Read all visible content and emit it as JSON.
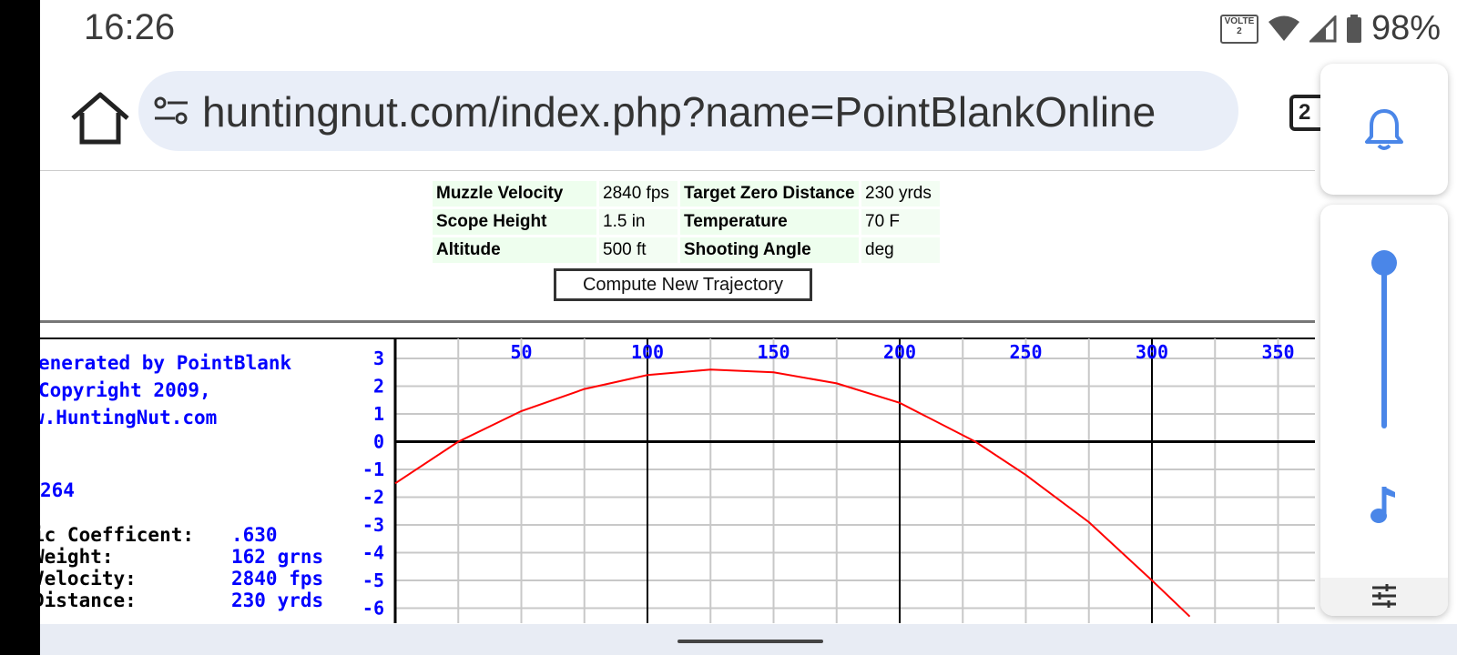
{
  "status_bar": {
    "time": "16:26",
    "volte_top": "VOLTE",
    "volte_bottom": "2",
    "battery_percent": "98%",
    "icons": [
      "volte-icon",
      "wifi-icon",
      "cell-signal-icon",
      "battery-icon"
    ]
  },
  "browser": {
    "url": "huntingnut.com/index.php?name=PointBlankOnline",
    "tabs_count": "2",
    "icons": [
      "home-icon",
      "site-settings-icon",
      "tabs-icon"
    ]
  },
  "params": {
    "rows": [
      {
        "label1": "Muzzle Velocity",
        "value1": "2840 fps",
        "label2": "Target Zero Distance",
        "value2": "230 yrds"
      },
      {
        "label1": "Scope Height",
        "value1": "1.5 in",
        "label2": "Temperature",
        "value2": "70 F"
      },
      {
        "label1": "Altitude",
        "value1": "500 ft",
        "label2": "Shooting Angle",
        "value2": "deg"
      }
    ],
    "button_label": "Compute New Trajectory"
  },
  "chart_info": {
    "lines": [
      "enerated by PointBlank",
      " Copyright 2009,",
      "w.HuntingNut.com"
    ],
    "caliber": "264",
    "details": [
      {
        "label": "ic Coefficent:",
        "value": ".630"
      },
      {
        "label": " Weight:",
        "value": "162 grns"
      },
      {
        "label": " Velocity:",
        "value": "2840 fps"
      },
      {
        "label": " Distance:",
        "value": "230 yrds"
      }
    ]
  },
  "chart_data": {
    "type": "line",
    "x_tick_labels": [
      "50",
      "100",
      "150",
      "200",
      "250",
      "300",
      "350"
    ],
    "y_tick_labels": [
      "3",
      "2",
      "1",
      "0",
      "-1",
      "-2",
      "-3",
      "-4",
      "-5",
      "-6"
    ],
    "x_range": [
      0,
      350
    ],
    "y_range": [
      -6,
      3
    ],
    "grid": true,
    "series": [
      {
        "color": "#ff0000",
        "x": [
          0,
          25,
          50,
          75,
          100,
          125,
          150,
          175,
          200,
          230,
          250,
          275,
          300,
          315
        ],
        "values": [
          -1.5,
          0.0,
          1.1,
          1.9,
          2.4,
          2.6,
          2.5,
          2.1,
          1.4,
          0.0,
          -1.2,
          -2.9,
          -5.0,
          -6.3
        ]
      }
    ],
    "colors": {
      "axis_labels": "#0000ff",
      "curve": "#ff0000",
      "grid": "#c8c8c8",
      "zero_line": "#000000"
    }
  },
  "volume_panel": {
    "ringer_icon": "bell-icon",
    "media_icon": "music-note-icon",
    "settings_icon": "sliders-icon",
    "level": 1.0,
    "accent": "#4a86e8"
  }
}
